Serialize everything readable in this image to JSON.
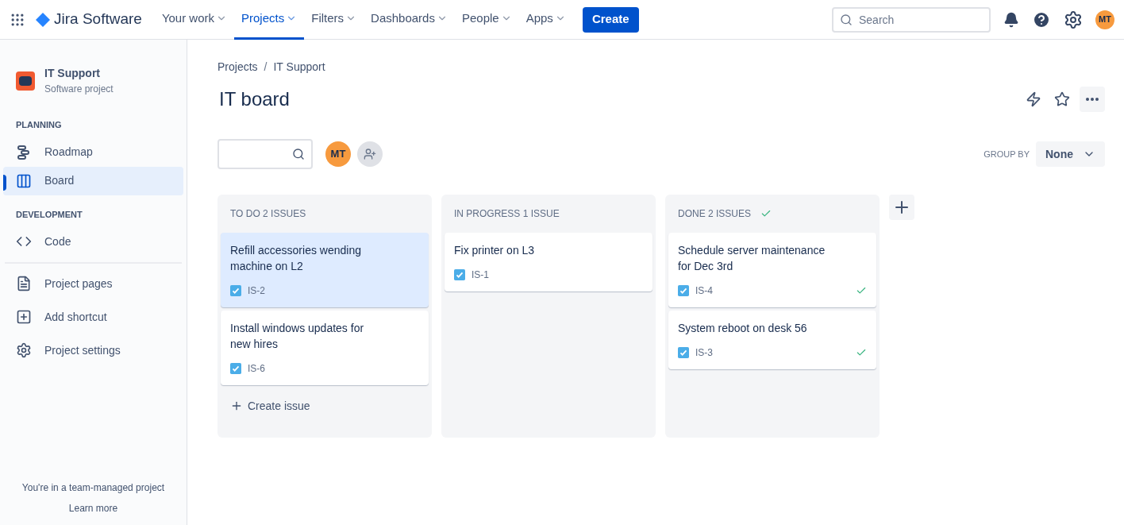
{
  "topbar": {
    "product": "Jira Software",
    "menus": [
      {
        "label": "Your work",
        "selected": false
      },
      {
        "label": "Projects",
        "selected": true
      },
      {
        "label": "Filters",
        "selected": false
      },
      {
        "label": "Dashboards",
        "selected": false
      },
      {
        "label": "People",
        "selected": false
      },
      {
        "label": "Apps",
        "selected": false
      }
    ],
    "create": "Create",
    "search": {
      "placeholder": "Search"
    },
    "avatar": "MT"
  },
  "sidebar": {
    "project": {
      "name": "IT Support",
      "type": "Software project"
    },
    "sections": [
      {
        "heading": "PLANNING",
        "items": [
          {
            "kind": "roadmap",
            "label": "Roadmap",
            "selected": false
          },
          {
            "kind": "board",
            "label": "Board",
            "selected": true
          }
        ]
      },
      {
        "heading": "DEVELOPMENT",
        "items": [
          {
            "kind": "code",
            "label": "Code",
            "selected": false
          }
        ]
      }
    ],
    "links": [
      {
        "kind": "pages",
        "label": "Project pages"
      },
      {
        "kind": "shortcut",
        "label": "Add shortcut"
      },
      {
        "kind": "settings",
        "label": "Project settings"
      }
    ],
    "footer": {
      "text": "You're in a team-managed project",
      "link": "Learn more"
    }
  },
  "breadcrumbs": {
    "separator": "/",
    "items": [
      "Projects",
      "IT Support"
    ]
  },
  "title": "IT board",
  "filters": {
    "avatar": "MT",
    "group_by": {
      "label": "GROUP BY",
      "value": "None"
    }
  },
  "columns": [
    {
      "title": "TO DO 2 ISSUES",
      "done": false,
      "create": "Create issue",
      "cards": [
        {
          "title": "Refill accessories wending machine on L2",
          "key": "IS-2",
          "selected": true,
          "done": false
        },
        {
          "title": "Install windows updates for new hires",
          "key": "IS-6",
          "selected": false,
          "done": false
        }
      ]
    },
    {
      "title": "IN PROGRESS 1 ISSUE",
      "done": false,
      "cards": [
        {
          "title": "Fix printer on L3",
          "key": "IS-1",
          "selected": false,
          "done": false
        }
      ]
    },
    {
      "title": "DONE 2 ISSUES",
      "done": true,
      "cards": [
        {
          "title": "Schedule server maintenance for Dec 3rd",
          "key": "IS-4",
          "selected": false,
          "done": true
        },
        {
          "title": "System reboot on desk 56",
          "key": "IS-3",
          "selected": false,
          "done": true
        }
      ]
    }
  ]
}
